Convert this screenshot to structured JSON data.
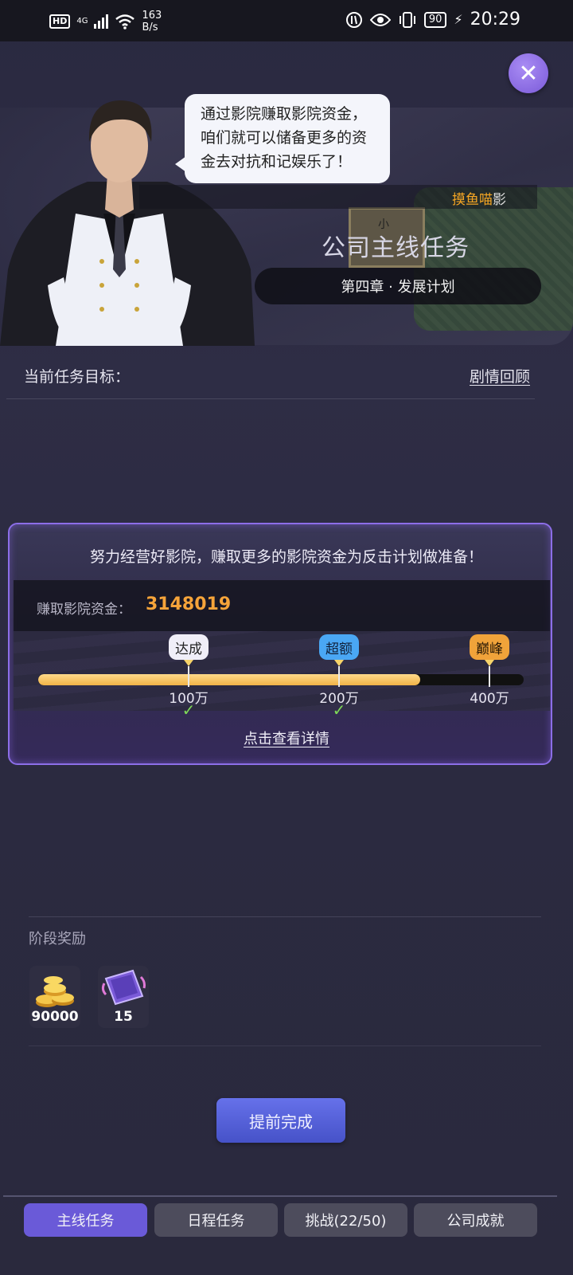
{
  "status_bar": {
    "hd": "HD",
    "network": "4G",
    "speed_value": "163",
    "speed_unit": "B/s",
    "battery": "90",
    "time": "20:29"
  },
  "header": {
    "close_icon": "close-icon",
    "speech": [
      "通过影院赚取影院资金，",
      "咱们就可以储备更多的资",
      "金去对抗和记娱乐了！"
    ],
    "watermark_a": "摸鱼喵",
    "watermark_b": "影",
    "sign_text": "小",
    "mission_title": "公司主线任务",
    "chapter": "第四章 · 发展计划"
  },
  "goal": {
    "label": "当前任务目标：",
    "review_link": "剧情回顾"
  },
  "task": {
    "description": "努力经营好影院，赚取更多的影院资金为反击计划做准备！",
    "earn_label": "赚取影院资金：",
    "earn_value": "3148019",
    "progress_fraction": 0.787,
    "milestones": [
      {
        "tag": "达成",
        "value": "100万",
        "done": true
      },
      {
        "tag": "超额",
        "value": "200万",
        "done": true
      },
      {
        "tag": "巅峰",
        "value": "400万",
        "done": false
      }
    ],
    "details_link": "点击查看详情"
  },
  "rewards": {
    "heading": "阶段奖励",
    "items": [
      {
        "icon": "gold-coins-icon",
        "amount": "90000"
      },
      {
        "icon": "purple-card-icon",
        "amount": "15"
      }
    ]
  },
  "finish_button": "提前完成",
  "tabs": [
    {
      "label": "主线任务",
      "active": true
    },
    {
      "label": "日程任务",
      "active": false
    },
    {
      "label": "挑战(22/50)",
      "active": false
    },
    {
      "label": "公司成就",
      "active": false
    }
  ],
  "colors": {
    "accent": "#6a5ad8",
    "earn_value": "#f6a43a",
    "progress": "#f1b348",
    "card_border": "#8c6ee8"
  }
}
